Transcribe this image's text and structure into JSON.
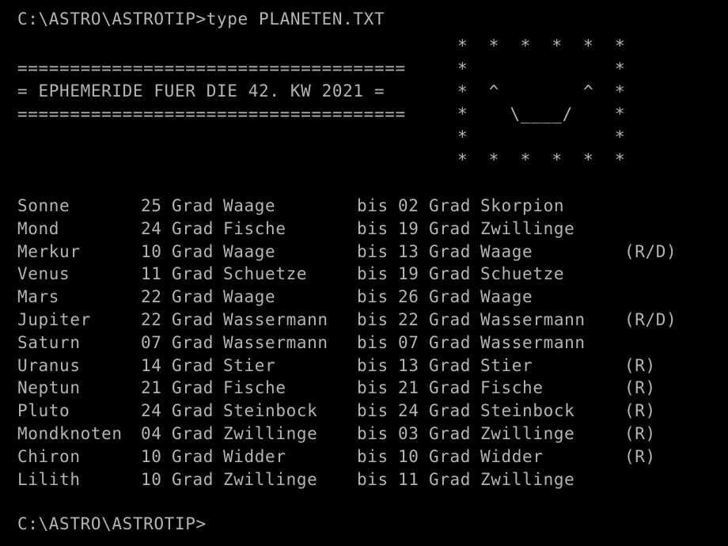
{
  "terminal": {
    "command_line": "C:\\ASTRO\\ASTROTIP>type PLANETEN.TXT",
    "prompt_line": "C:\\ASTRO\\ASTROTIP>",
    "text_color": "#b4b4b4",
    "background_color": "#000000"
  },
  "header": {
    "rule_top": "=====================================",
    "title": "= EPHEMERIDE FUER DIE 42. KW 2021 =",
    "rule_bottom": "====================================="
  },
  "ascii_art": {
    "name": "smiley-face-star-border",
    "rows": [
      "*  *  *  *  *  *",
      "*              *",
      "*  ^        ^  *",
      "*    \\____/    *",
      "*              *",
      "*  *  *  *  *  *"
    ]
  },
  "table": {
    "degree_unit": "Grad",
    "range_word": "bis",
    "rows": [
      {
        "body": "Sonne",
        "from_degree": "25",
        "from_unit": "Grad",
        "from_sign": "Waage",
        "bis": "bis",
        "to_degree": "02",
        "to_unit": "Grad",
        "to_sign": "Skorpion",
        "retrograde": ""
      },
      {
        "body": "Mond",
        "from_degree": "24",
        "from_unit": "Grad",
        "from_sign": "Fische",
        "bis": "bis",
        "to_degree": "19",
        "to_unit": "Grad",
        "to_sign": "Zwillinge",
        "retrograde": ""
      },
      {
        "body": "Merkur",
        "from_degree": "10",
        "from_unit": "Grad",
        "from_sign": "Waage",
        "bis": "bis",
        "to_degree": "13",
        "to_unit": "Grad",
        "to_sign": "Waage",
        "retrograde": "(R/D)"
      },
      {
        "body": "Venus",
        "from_degree": "11",
        "from_unit": "Grad",
        "from_sign": "Schuetze",
        "bis": "bis",
        "to_degree": "19",
        "to_unit": "Grad",
        "to_sign": "Schuetze",
        "retrograde": ""
      },
      {
        "body": "Mars",
        "from_degree": "22",
        "from_unit": "Grad",
        "from_sign": "Waage",
        "bis": "bis",
        "to_degree": "26",
        "to_unit": "Grad",
        "to_sign": "Waage",
        "retrograde": ""
      },
      {
        "body": "Jupiter",
        "from_degree": "22",
        "from_unit": "Grad",
        "from_sign": "Wassermann",
        "bis": "bis",
        "to_degree": "22",
        "to_unit": "Grad",
        "to_sign": "Wassermann",
        "retrograde": "(R/D)"
      },
      {
        "body": "Saturn",
        "from_degree": "07",
        "from_unit": "Grad",
        "from_sign": "Wassermann",
        "bis": "bis",
        "to_degree": "07",
        "to_unit": "Grad",
        "to_sign": "Wassermann",
        "retrograde": ""
      },
      {
        "body": "Uranus",
        "from_degree": "14",
        "from_unit": "Grad",
        "from_sign": "Stier",
        "bis": "bis",
        "to_degree": "13",
        "to_unit": "Grad",
        "to_sign": "Stier",
        "retrograde": "(R)"
      },
      {
        "body": "Neptun",
        "from_degree": "21",
        "from_unit": "Grad",
        "from_sign": "Fische",
        "bis": "bis",
        "to_degree": "21",
        "to_unit": "Grad",
        "to_sign": "Fische",
        "retrograde": "(R)"
      },
      {
        "body": "Pluto",
        "from_degree": "24",
        "from_unit": "Grad",
        "from_sign": "Steinbock",
        "bis": "bis",
        "to_degree": "24",
        "to_unit": "Grad",
        "to_sign": "Steinbock",
        "retrograde": "(R)"
      },
      {
        "body": "Mondknoten",
        "from_degree": "04",
        "from_unit": "Grad",
        "from_sign": "Zwillinge",
        "bis": "bis",
        "to_degree": "03",
        "to_unit": "Grad",
        "to_sign": "Zwillinge",
        "retrograde": "(R)"
      },
      {
        "body": "Chiron",
        "from_degree": "10",
        "from_unit": "Grad",
        "from_sign": "Widder",
        "bis": "bis",
        "to_degree": "10",
        "to_unit": "Grad",
        "to_sign": "Widder",
        "retrograde": "(R)"
      },
      {
        "body": "Lilith",
        "from_degree": "10",
        "from_unit": "Grad",
        "from_sign": "Zwillinge",
        "bis": "bis",
        "to_degree": "11",
        "to_unit": "Grad",
        "to_sign": "Zwillinge",
        "retrograde": ""
      }
    ]
  }
}
